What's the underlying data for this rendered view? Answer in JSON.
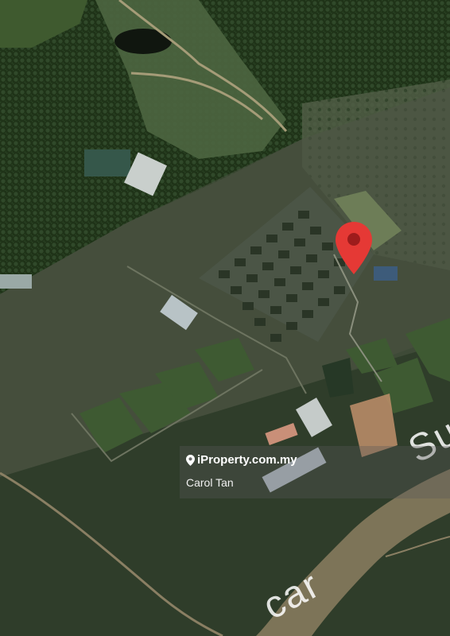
{
  "map": {
    "view": "satellite",
    "pin_icon": "map-marker-icon",
    "pin_color": "#e53935",
    "river_label_parts": [
      "Su",
      "car"
    ]
  },
  "watermark": {
    "brand_icon": "location-pin-icon",
    "brand_text": "iProperty.com.my",
    "agent_name": "Carol Tan"
  }
}
